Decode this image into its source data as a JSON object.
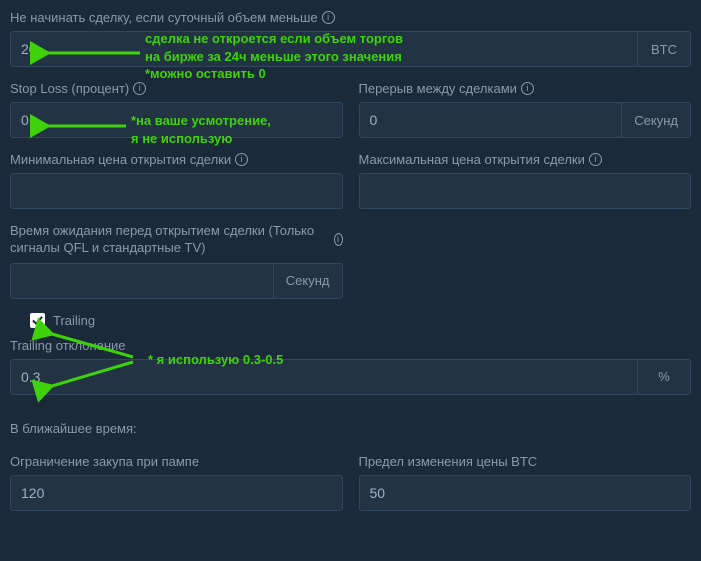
{
  "fields": {
    "daily_volume": {
      "label": "Не начинать сделку, если суточный объем меньше",
      "value": "20",
      "unit": "BTC"
    },
    "stop_loss": {
      "label": "Stop Loss (процент)",
      "value": "0"
    },
    "cooldown": {
      "label": "Перерыв между сделками",
      "value": "0",
      "unit": "Секунд"
    },
    "min_open_price": {
      "label": "Минимальная цена открытия сделки",
      "value": ""
    },
    "max_open_price": {
      "label": "Максимальная цена открытия сделки",
      "value": ""
    },
    "wait_time": {
      "label": "Время ожидания перед открытием сделки (Только сигналы QFL и стандартные TV)",
      "value": "",
      "unit": "Секунд"
    },
    "trailing": {
      "checkbox_label": "Trailing",
      "checked": true,
      "deviation_label": "Trailing отклонение",
      "deviation_value": "0.3",
      "deviation_unit": "%"
    },
    "coming_soon": "В ближайшее время:",
    "pump_limit": {
      "label": "Ограничение закупа при пампе",
      "value": "120"
    },
    "btc_change_limit": {
      "label": "Предел изменения цены BTC",
      "value": "50"
    }
  },
  "annotations": {
    "a1": "сделка не откроется если объем торгов\nна бирже за 24ч меньше этого значения\n*можно оставить 0",
    "a2": "*на ваше усмотрение,\nя не использую",
    "a3": "* я использую 0.3-0.5"
  }
}
